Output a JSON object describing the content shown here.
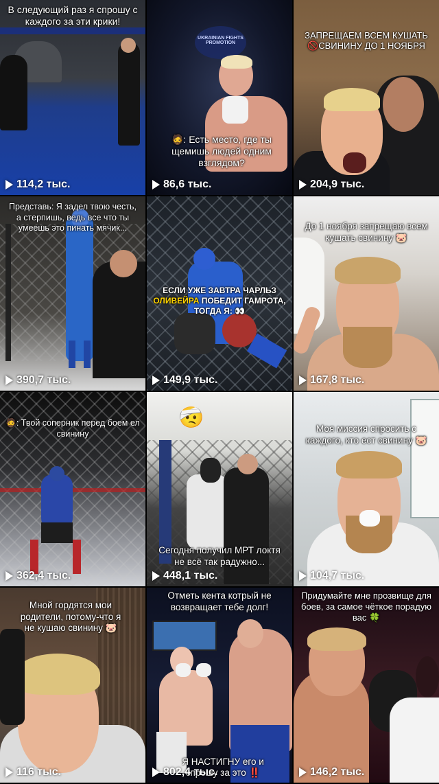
{
  "videos": [
    {
      "caption": "В следующий раз я спрошу с каждого за эти крики!",
      "views": "114,2 тыс."
    },
    {
      "caption": "🧔: Есть место, где ты щемишь людей одним взглядом?",
      "logo_text": "UKRAINIAN FIGHTS PROMOTION",
      "views": "86,6 тыс."
    },
    {
      "caption": "ЗАПРЕЩАЕМ ВСЕМ КУШАТЬ 🚫СВИНИНУ ДО 1 НОЯБРЯ",
      "views": "204,9 тыс."
    },
    {
      "caption": "Представь: Я задел твою честь, а стерпишь, ведь все что ты умеешь это пинать мячик...",
      "views": "390,7 тыс."
    },
    {
      "caption_part1": "ЕСЛИ УЖЕ ЗАВТРА ЧАРЛЬЗ ",
      "caption_highlight": "ОЛИВЕЙРА",
      "caption_part2": " ПОБЕДИТ ГАМРОТА, ТОГДА Я: 👀",
      "views": "149,9 тыс."
    },
    {
      "caption": "До 1 ноября запрещаю всем кушать свинину 🐷",
      "views": "167,8 тыс."
    },
    {
      "caption": "🧔: Твой соперник перед боем ел свинину",
      "views": "362,4 тыс."
    },
    {
      "caption": "Сегодня получил МРТ локтя не всё так радужно...",
      "emoji": "🤕",
      "views": "448,1 тыс."
    },
    {
      "caption": "Моя миссия спросить с каждого, кто ест свинину 🐷",
      "views": "104,7 тыс."
    },
    {
      "caption": "Мной гордятся мои родители, потому-что я не кушаю свинину 🐷",
      "views": "116 тыс."
    },
    {
      "caption": "Отметь кента котрый не возвращает тебе долг!",
      "caption_bottom": "Я НАСТИГНУ его и спрошу за это ‼️",
      "views": "802,4 тыс."
    },
    {
      "caption": "Придумайте мне прозвище для боев, за самое чёткое порадую вас 🍀",
      "views": "146,2 тыс."
    }
  ],
  "colors": {
    "background": "#000000",
    "text": "#ffffff",
    "highlight": "#ffd400"
  },
  "icons": {
    "views": "play-icon"
  }
}
